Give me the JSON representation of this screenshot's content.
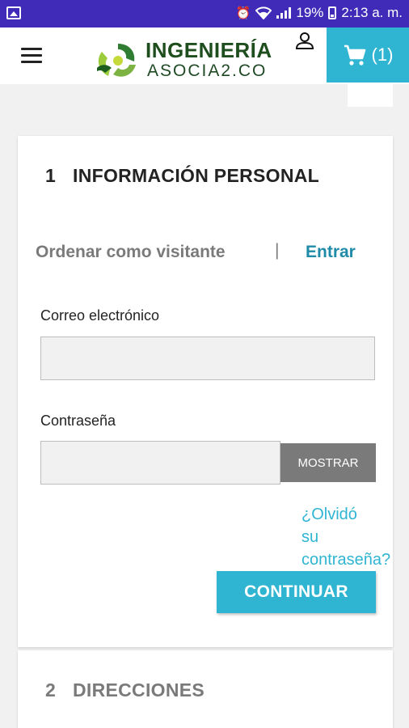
{
  "status_bar": {
    "battery": "19%",
    "time": "2:13 a. m."
  },
  "header": {
    "logo_line1": "INGENIERÍA",
    "logo_line2": "ASOCIA2.CO",
    "cart_count": "(1)"
  },
  "checkout": {
    "step1": {
      "number": "1",
      "title": "INFORMACIÓN PERSONAL"
    },
    "tabs": {
      "guest": "Ordenar como visitante",
      "separator": "|",
      "login": "Entrar"
    },
    "email": {
      "label": "Correo electrónico",
      "value": ""
    },
    "password": {
      "label": "Contraseña",
      "value": "",
      "show_button": "MOSTRAR"
    },
    "forgot": {
      "line1": "¿Olvidó",
      "line2": "su",
      "line3": "contraseña?"
    },
    "continue_button": "CONTINUAR",
    "step2": {
      "number": "2",
      "title": "DIRECCIONES"
    }
  },
  "colors": {
    "status_bar": "#3f2bb8",
    "accent": "#2fb5d2",
    "muted_button": "#7a7a7a",
    "logo_green": "#1e4d1e"
  },
  "icons": [
    "image-icon",
    "alarm-icon",
    "wifi-icon",
    "signal-icon",
    "battery-icon",
    "menu-icon",
    "user-icon",
    "cart-icon"
  ]
}
